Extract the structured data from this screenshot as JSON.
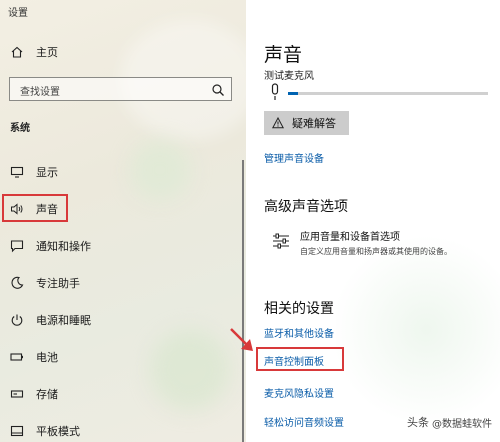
{
  "sidebar": {
    "window_title": "设置",
    "home_label": "主页",
    "search_placeholder": "查找设置",
    "section_label": "系统",
    "items": [
      {
        "label": "显示",
        "icon": "display-icon"
      },
      {
        "label": "声音",
        "icon": "speaker-icon",
        "selected": true
      },
      {
        "label": "通知和操作",
        "icon": "notification-icon"
      },
      {
        "label": "专注助手",
        "icon": "moon-icon"
      },
      {
        "label": "电源和睡眠",
        "icon": "power-icon"
      },
      {
        "label": "电池",
        "icon": "battery-icon"
      },
      {
        "label": "存储",
        "icon": "storage-icon"
      },
      {
        "label": "平板模式",
        "icon": "tablet-icon"
      }
    ]
  },
  "main": {
    "title": "声音",
    "mic_test_label": "测试麦克风",
    "mic_level": 0.05,
    "troubleshoot_label": "疑难解答",
    "manage_devices_link": "管理声音设备",
    "advanced_title": "高级声音选项",
    "app_volume_title": "应用音量和设备首选项",
    "app_volume_desc": "自定义应用音量和扬声器或其使用的设备。",
    "related_title": "相关的设置",
    "related_links": [
      "蓝牙和其他设备",
      "声音控制面板",
      "麦克风隐私设置",
      "轻松访问音频设置"
    ]
  },
  "watermark": {
    "brand": "头条",
    "text": "@数据蛙软件"
  },
  "colors": {
    "accent_link": "#0a5ca8",
    "highlight_box": "#d8393a",
    "mic_fill": "#0063b1"
  }
}
